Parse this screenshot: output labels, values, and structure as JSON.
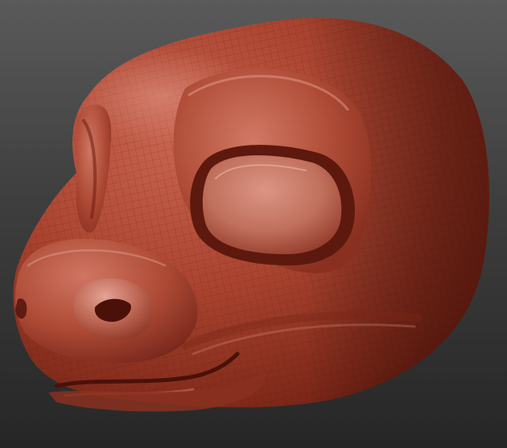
{
  "scene": {
    "subject": "sculpted-creature-head",
    "colors": {
      "clay_base": "#a9432f",
      "clay_highlight": "#d98a78",
      "clay_shadow": "#5a160c",
      "background_top": "#5a5a5a",
      "background_bottom": "#262626"
    }
  }
}
